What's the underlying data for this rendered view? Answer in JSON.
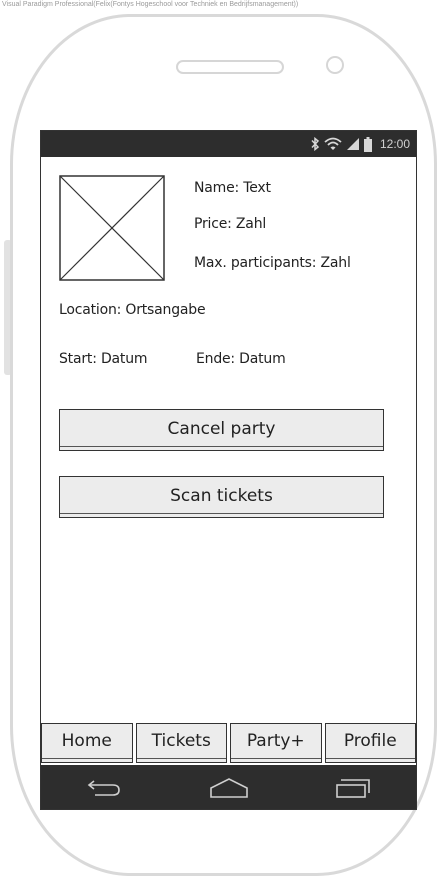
{
  "watermark": "Visual Paradigm Professional(Felix(Fontys Hogeschool voor Techniek en Bedrijfsmanagement))",
  "status_bar": {
    "time": "12:00"
  },
  "details": {
    "name": "Name: Text",
    "price": "Price: Zahl",
    "max_participants": "Max. participants: Zahl",
    "location": "Location: Ortsangabe",
    "start": "Start: Datum",
    "end": "Ende: Datum"
  },
  "actions": {
    "cancel_label": "Cancel party",
    "scan_label": "Scan tickets"
  },
  "tabs": [
    {
      "label": "Home"
    },
    {
      "label": "Tickets"
    },
    {
      "label": "Party+"
    },
    {
      "label": "Profile"
    }
  ],
  "colors": {
    "status_bar_bg": "#2d2d2d",
    "button_bg": "#ececec",
    "frame": "#d9d9d9"
  }
}
